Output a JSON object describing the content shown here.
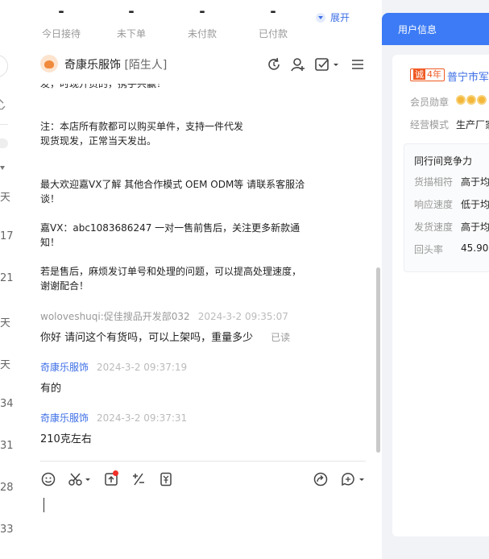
{
  "stats": [
    {
      "value": "-",
      "label": "今日接待"
    },
    {
      "value": "-",
      "label": "未下单"
    },
    {
      "value": "-",
      "label": "未付款"
    },
    {
      "value": "-",
      "label": "已付款"
    }
  ],
  "expand_label": "展开",
  "left_strip_numbers": [
    "天",
    "17",
    "21",
    "天",
    "天",
    "34",
    "31",
    "28",
    "33"
  ],
  "chat": {
    "shop_name": "奇康乐服饰",
    "shop_tag": "[陌生人]",
    "messages_system": [
      "发，时现开货的，携手共赢！",
      "注：本店所有款都可以购买单件，支持一件代发",
      "现货现发，正常当天发出。",
      "最大欢迎嘉VX了解 其他合作模式 OEM ODM等 请联系客服洽",
      "谈！",
      "嘉VX：abc1083686247 一对一售前售后，关注更多新款通",
      "知！",
      "若是售后，麻烦发订单号和处理的问题，可以提高处理速度，",
      "谢谢配合！"
    ],
    "messages": [
      {
        "sender": "woloveshuqi:促佳搜品开发部032",
        "time": "2024-3-2 09:35:07",
        "text": "你好 请问这个有货吗，可以上架吗，重量多少",
        "status": "已读"
      },
      {
        "sender": "奇康乐服饰",
        "time": "2024-3-2 09:37:19",
        "text": "有的"
      },
      {
        "sender": "奇康乐服饰",
        "time": "2024-3-2 09:37:31",
        "text": "210克左右"
      }
    ]
  },
  "right": {
    "tab_label": "用户信息",
    "years_badge_icon": "诚",
    "years_badge": "4年",
    "company": "普宁市军",
    "medal_label": "会员勋章",
    "mode_label": "经营模式",
    "mode_value": "生产厂家",
    "competition_title": "同行间竞争力",
    "competition": [
      {
        "label": "货描相符",
        "value": "高于均"
      },
      {
        "label": "响应速度",
        "value": "低于均"
      },
      {
        "label": "发货速度",
        "value": "高于均"
      },
      {
        "label": "回头率",
        "value": "45.90%"
      }
    ]
  }
}
